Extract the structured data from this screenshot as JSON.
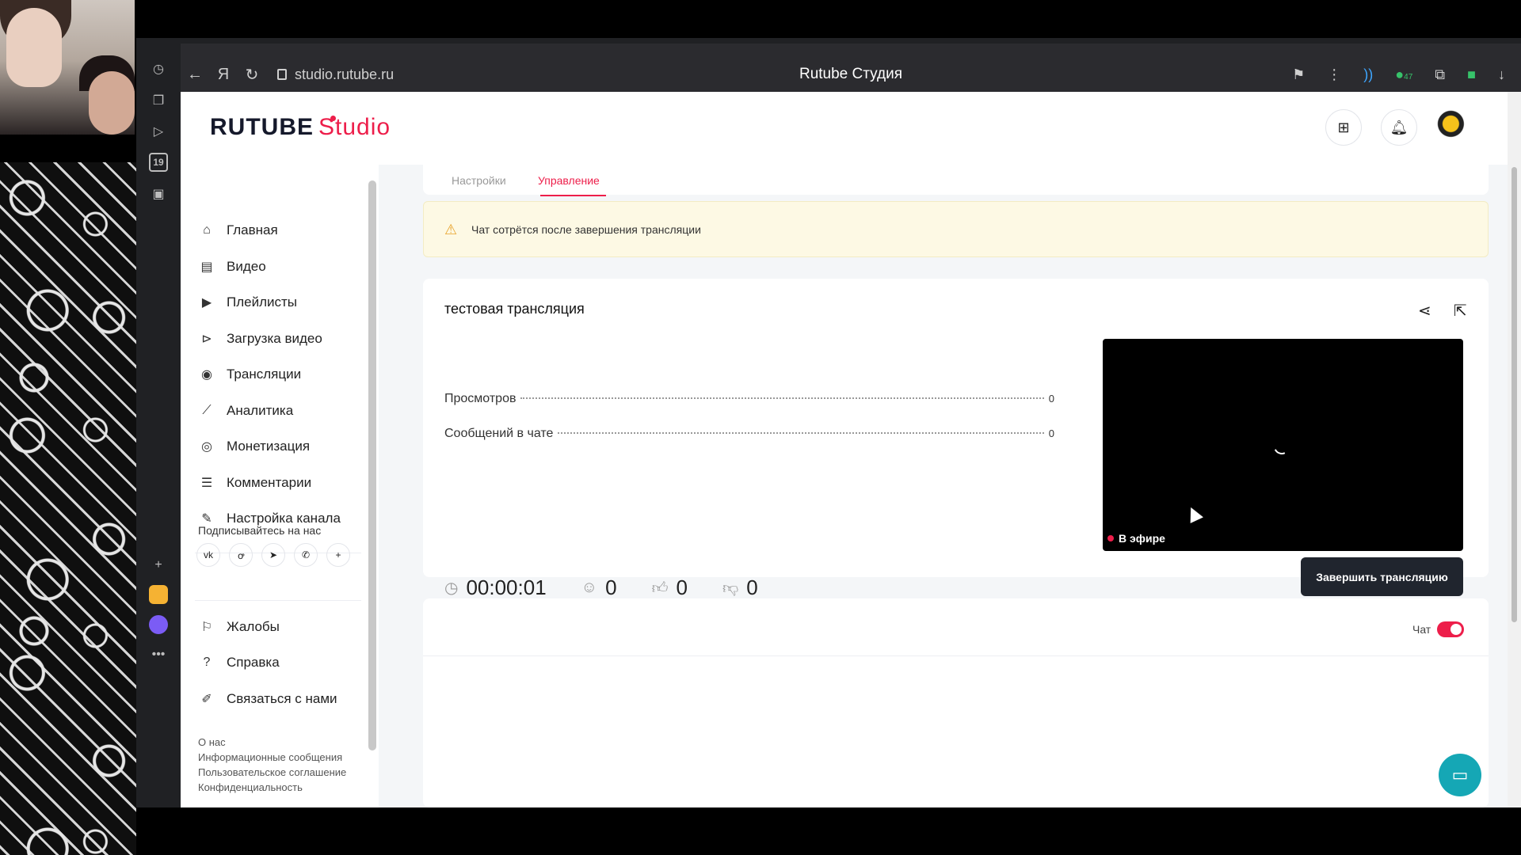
{
  "browser": {
    "url": "studio.rutube.ru",
    "window_title": "Rutube Студия",
    "badge_count": "47",
    "calendar_day": "19"
  },
  "header": {
    "logo_main": "RUTUBE",
    "logo_studio": "Studio"
  },
  "sidebar": {
    "items": [
      {
        "label": "Главная",
        "icon": "home-icon"
      },
      {
        "label": "Видео",
        "icon": "video-icon"
      },
      {
        "label": "Плейлисты",
        "icon": "playlist-icon"
      },
      {
        "label": "Загрузка видео",
        "icon": "upload-icon"
      },
      {
        "label": "Трансляции",
        "icon": "broadcast-icon"
      },
      {
        "label": "Аналитика",
        "icon": "analytics-icon"
      },
      {
        "label": "Монетизация",
        "icon": "monetization-icon"
      },
      {
        "label": "Комментарии",
        "icon": "comments-icon"
      },
      {
        "label": "Настройка канала",
        "icon": "settings-wand-icon"
      }
    ],
    "follow_title": "Подписывайтесь на нас",
    "social": [
      "vk",
      "ok",
      "telegram",
      "viber",
      "+"
    ],
    "bottom_items": [
      {
        "label": "Жалобы",
        "icon": "flag-icon"
      },
      {
        "label": "Справка",
        "icon": "help-icon"
      },
      {
        "label": "Связаться с нами",
        "icon": "edit-icon"
      }
    ],
    "footer_links": [
      "О нас",
      "Информационные сообщения",
      "Пользовательское соглашение",
      "Конфиденциальность"
    ]
  },
  "tabs": [
    {
      "label": "Настройки",
      "active": false
    },
    {
      "label": "Управление",
      "active": true
    }
  ],
  "warning": {
    "text": "Чат сотрётся после завершения трансляции"
  },
  "stream": {
    "title": "тестовая трансляция",
    "stats": [
      {
        "label": "Просмотров",
        "value": "0"
      },
      {
        "label": "Сообщений в чате",
        "value": "0"
      }
    ],
    "live_badge": "В эфире",
    "duration": "00:00:01",
    "viewers": "0",
    "likes": "0",
    "dislikes": "0",
    "end_button": "Завершить трансляцию"
  },
  "chat": {
    "label": "Чат",
    "enabled": true
  },
  "colors": {
    "accent": "#ed1e4a",
    "dark_button": "#20252e",
    "fab": "#15a7b5"
  }
}
